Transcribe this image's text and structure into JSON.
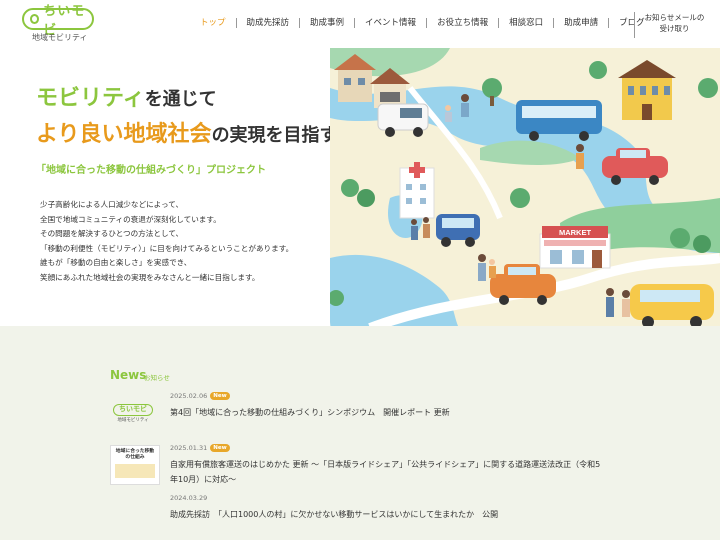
{
  "brand": {
    "logo_text": "ちいモビ",
    "logo_sub": "地域モビリティ",
    "accent_green": "#8cc63e",
    "accent_orange": "#e89a1c"
  },
  "nav": {
    "items": [
      "トップ",
      "助成先採訪",
      "助成事例",
      "イベント情報",
      "お役立ち情報",
      "相談窓口",
      "助成申請",
      "ブログ"
    ],
    "notice_line1": "お知らせメールの",
    "notice_line2": "受け取り"
  },
  "hero": {
    "line1_highlight": "モビリティ",
    "line1_rest": "を通じて",
    "line2_highlight": "より良い地域社会",
    "line2_rest": "の実現を目指す",
    "subtitle": "「地域に合った移動の仕組みづくり」プロジェクト",
    "body": [
      "少子高齢化による人口減少などによって、",
      "全国で地域コミュニティの衰退が深刻化しています。",
      "その問題を解決するひとつの方法として、",
      "「移動の利便性（モビリティ）」に目を向けてみるということがあります。",
      "誰もが「移動の自由と楽しさ」を実感でき、",
      "笑顔にあふれた地域社会の実現をみなさんと一緒に目指します。"
    ],
    "market_sign": "MARKET"
  },
  "news": {
    "title": "News",
    "subtitle": "お知らせ",
    "items": [
      {
        "date": "2025.02.06",
        "badge": "New",
        "lines": [
          "第4回「地域に合った移動の仕組みづくり」シンポジウム　開催レポート 更新"
        ]
      },
      {
        "date": "2025.01.31",
        "badge": "New",
        "thumb_title": "地域に合った移動の仕組み",
        "lines": [
          "自家用有償旅客運送のはじめかた 更新 〜「日本版ライドシェア」「公共ライドシェア」に関する道路運送法改正（令和5",
          "年10月）に対応〜"
        ]
      },
      {
        "date": "2024.03.29",
        "badge": "",
        "lines": [
          "助成先採訪　「人口1000人の村」に欠かせない移動サービスはいかにして生まれたか　公開"
        ]
      }
    ]
  }
}
